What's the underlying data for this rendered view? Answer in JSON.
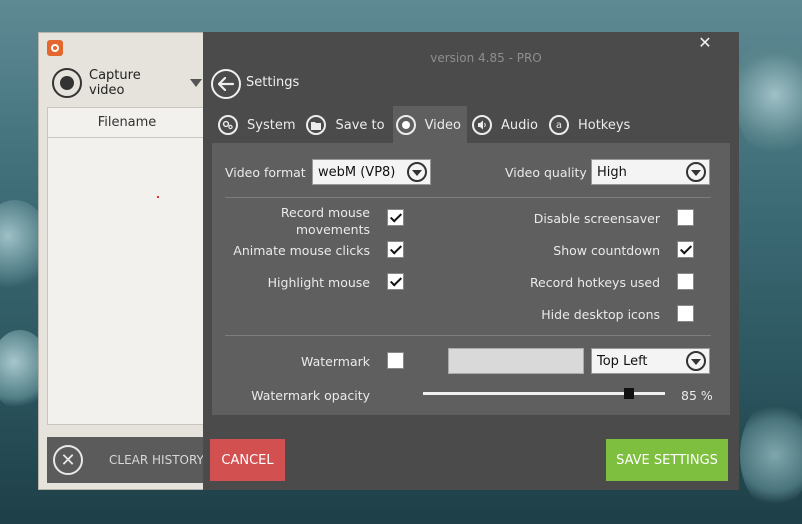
{
  "left": {
    "capture_label": "Capture video",
    "history_header": "Filename",
    "clear_label": "CLEAR HISTORY"
  },
  "settings": {
    "version": "version 4.85 - PRO",
    "title": "Settings",
    "tabs": [
      {
        "label": "System",
        "icon": "gear-icon"
      },
      {
        "label": "Save to",
        "icon": "folder-icon"
      },
      {
        "label": "Video",
        "icon": "record-icon",
        "active": true
      },
      {
        "label": "Audio",
        "icon": "speaker-icon"
      },
      {
        "label": "Hotkeys",
        "icon": "keyboard-icon"
      }
    ],
    "video_format_label": "Video format",
    "video_format_value": "webM (VP8)",
    "video_quality_label": "Video quality",
    "video_quality_value": "High",
    "options_left": [
      {
        "label": "Record mouse movements",
        "checked": true
      },
      {
        "label": "Animate mouse clicks",
        "checked": true
      },
      {
        "label": "Highlight mouse",
        "checked": true
      }
    ],
    "options_right": [
      {
        "label": "Disable screensaver",
        "checked": false
      },
      {
        "label": "Show countdown",
        "checked": true
      },
      {
        "label": "Record hotkeys used",
        "checked": false
      },
      {
        "label": "Hide desktop icons",
        "checked": false
      }
    ],
    "watermark_label": "Watermark",
    "watermark_checked": false,
    "watermark_position": "Top Left",
    "opacity_label": "Watermark opacity",
    "opacity_value": 85,
    "opacity_text": "85 %",
    "cancel_label": "CANCEL",
    "save_label": "SAVE SETTINGS"
  },
  "colors": {
    "cancel": "#d25050",
    "save": "#7fbf3f",
    "panel": "#4b4b4b"
  }
}
